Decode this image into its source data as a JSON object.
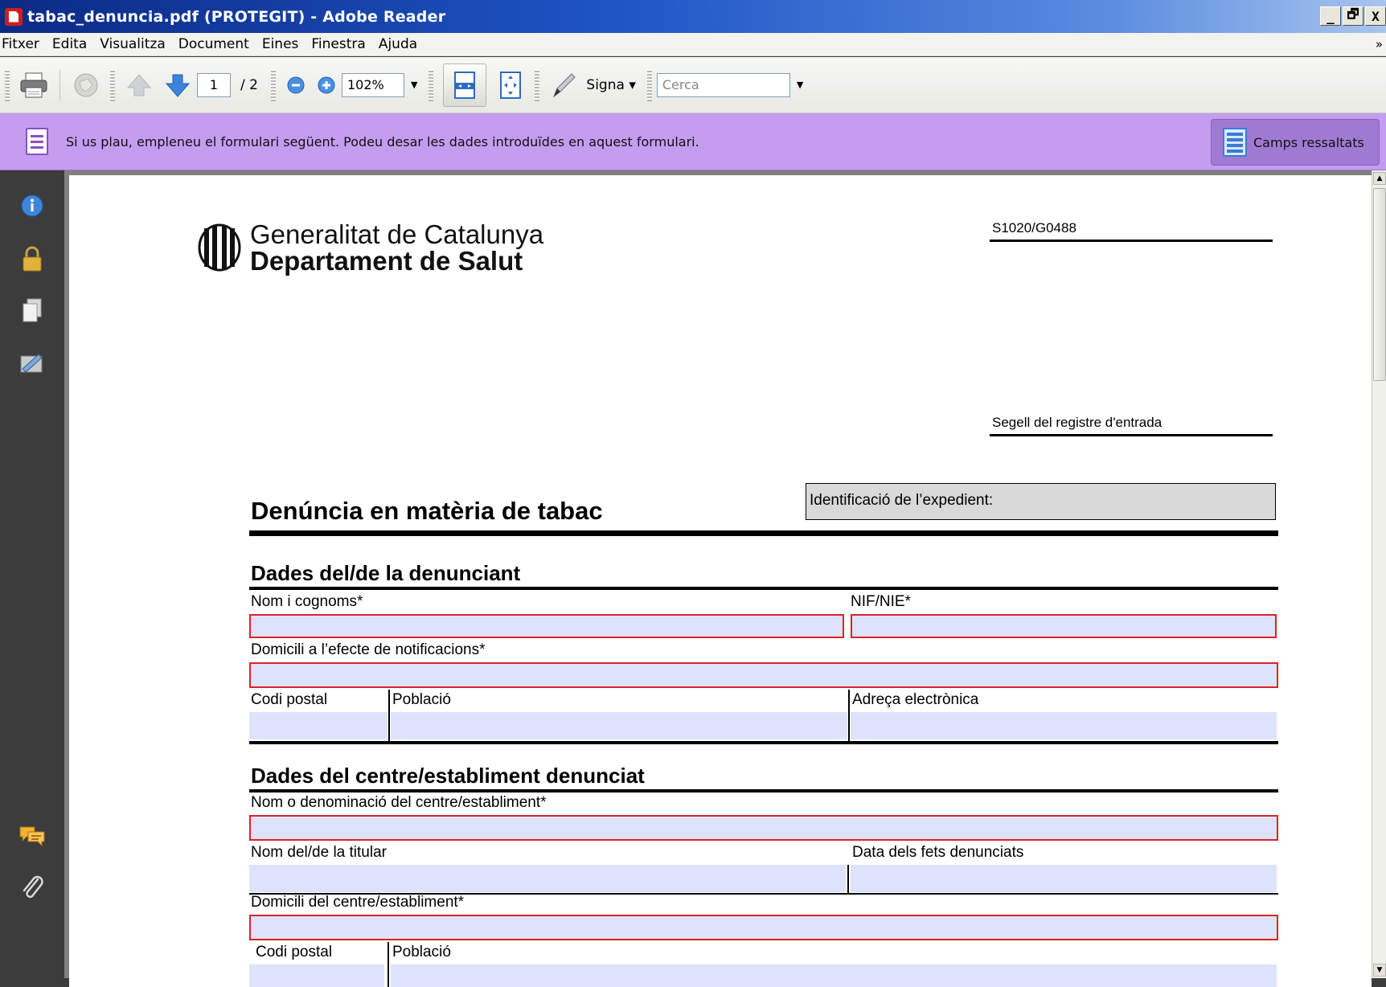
{
  "window": {
    "title": "tabac_denuncia.pdf (PROTEGIT) - Adobe Reader",
    "buttons": [
      "_",
      "🗗",
      "X"
    ]
  },
  "menu": [
    "Fitxer",
    "Edita",
    "Visualitza",
    "Document",
    "Eines",
    "Finestra",
    "Ajuda"
  ],
  "menu_more": "»",
  "toolbar": {
    "page_current": "1",
    "page_total": "/ 2",
    "zoom": "102%",
    "sign_label": "Signa ▾",
    "search_placeholder": "Cerca"
  },
  "form_bar": {
    "message": "Si us plau, empleneu el formulari següent. Podeu desar les dades introduïdes en aquest formulari.",
    "highlight_button": "Camps ressaltats"
  },
  "document": {
    "org_line1": "Generalitat de Catalunya",
    "org_line2": "Departament de Salut",
    "code": "S1020/G0488",
    "stamp_label": "Segell del registre d'entrada",
    "expedient_label": "Identificació de l’expedient:",
    "title": "Denúncia en matèria de tabac",
    "section1": {
      "title": "Dades del/de la denunciant",
      "name_label": "Nom i cognoms*",
      "nif_label": "NIF/NIE*",
      "address_label": "Domicili a l’efecte de notificacions*",
      "postal_label": "Codi postal",
      "town_label": "Població",
      "email_label": "Adreça electrònica"
    },
    "section2": {
      "title": "Dades del centre/establiment denunciat",
      "name_label": "Nom o denominació del centre/establiment*",
      "owner_label": "Nom del/de la titular",
      "date_label": "Data dels fets denunciats",
      "address_label": "Domicili del centre/establiment*",
      "postal_label": "Codi postal",
      "town_label": "Població"
    }
  },
  "colors": {
    "form_bar": "#c59df0",
    "field_fill": "#dde3fb",
    "required_border": "#e0202c",
    "title_bar": "#0b2a84"
  }
}
